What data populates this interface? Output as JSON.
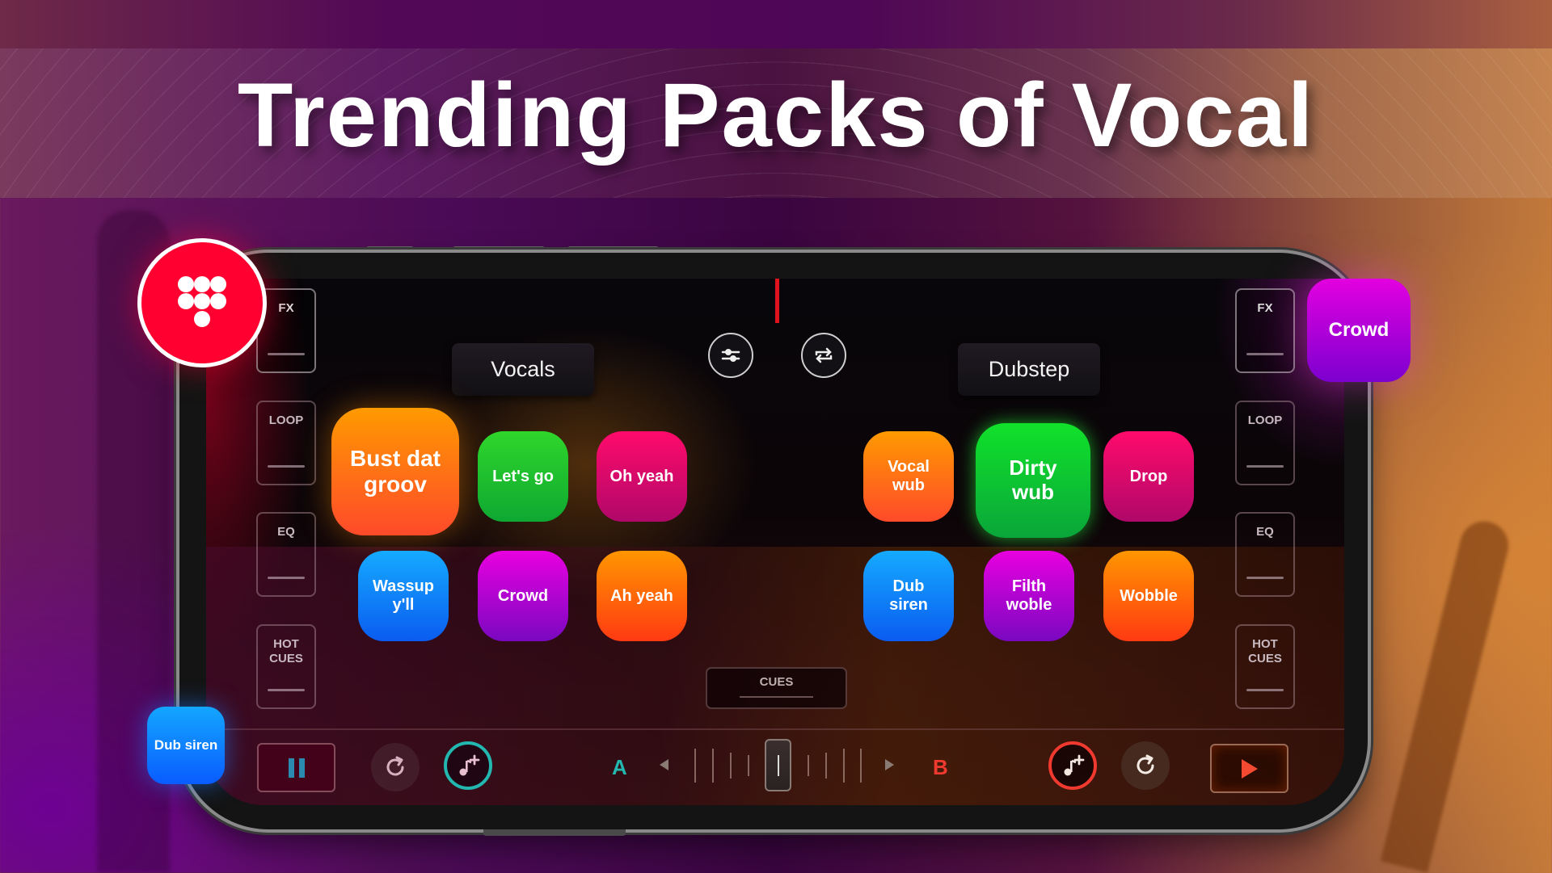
{
  "title": "Trending Packs of Vocal",
  "app": {
    "left_deck": {
      "controls": [
        "FX",
        "LOOP",
        "EQ",
        "HOT CUES"
      ],
      "pack_name": "Vocals",
      "pads": [
        {
          "label": "Bust dat groov",
          "color": "#ff7a10"
        },
        {
          "label": "Let's go",
          "color": "#1ec02a"
        },
        {
          "label": "Oh yeah",
          "color": "#e00a6a"
        },
        {
          "label": "Wassup y'll",
          "color": "#1080f5"
        },
        {
          "label": "Crowd",
          "color": "#b004d8"
        },
        {
          "label": "Ah yeah",
          "color": "#ff6a08"
        }
      ],
      "transport": {
        "state": "paused"
      },
      "accent": "#22b8b0",
      "deck_letter": "A"
    },
    "right_deck": {
      "controls": [
        "FX",
        "LOOP",
        "EQ",
        "HOT CUES"
      ],
      "pack_name": "Dubstep",
      "pads": [
        {
          "label": "Vocal wub",
          "color": "#ff7a10"
        },
        {
          "label": "Dirty wub",
          "color": "#10d22e",
          "active": true
        },
        {
          "label": "Drop",
          "color": "#e00a6a"
        },
        {
          "label": "Dub siren",
          "color": "#1080f5"
        },
        {
          "label": "Filth woble",
          "color": "#b004d8"
        },
        {
          "label": "Wobble",
          "color": "#ff6a08"
        }
      ],
      "transport": {
        "state": "stopped"
      },
      "accent": "#f03a30",
      "deck_letter": "B"
    },
    "center": {
      "mixer_icon": "sliders-icon",
      "sync_icon": "repeat-icon",
      "cues_label": "CUES",
      "crossfader_position": 0.5
    }
  },
  "floating_badges": {
    "logo_icon": "dot-grid-logo-icon",
    "crowd": "Crowd",
    "dub_siren": "Dub siren"
  },
  "colors": {
    "brand_red": "#ff0030",
    "deck_a": "#22b8b0",
    "deck_b": "#f03a30"
  }
}
